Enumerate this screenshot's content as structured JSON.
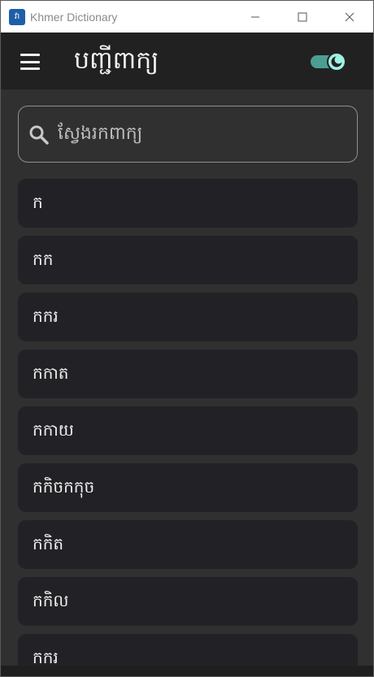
{
  "window": {
    "title": "Khmer Dictionary",
    "icon_label": "វា"
  },
  "appbar": {
    "title": "បញ្ជីពាក្យ",
    "menu_icon": "hamburger-menu-icon",
    "theme_toggle_state": "dark",
    "accent_color": "#4d9e92",
    "knob_color": "#9ff1e1"
  },
  "search": {
    "placeholder": "ស្វែងរកពាក្យ"
  },
  "words": [
    {
      "text": "ក"
    },
    {
      "text": "កក"
    },
    {
      "text": "កករ"
    },
    {
      "text": "កកាត"
    },
    {
      "text": "កកាយ"
    },
    {
      "text": "កកិចកកុច"
    },
    {
      "text": "កកិត"
    },
    {
      "text": "កកិល"
    },
    {
      "text": "កករ"
    }
  ]
}
